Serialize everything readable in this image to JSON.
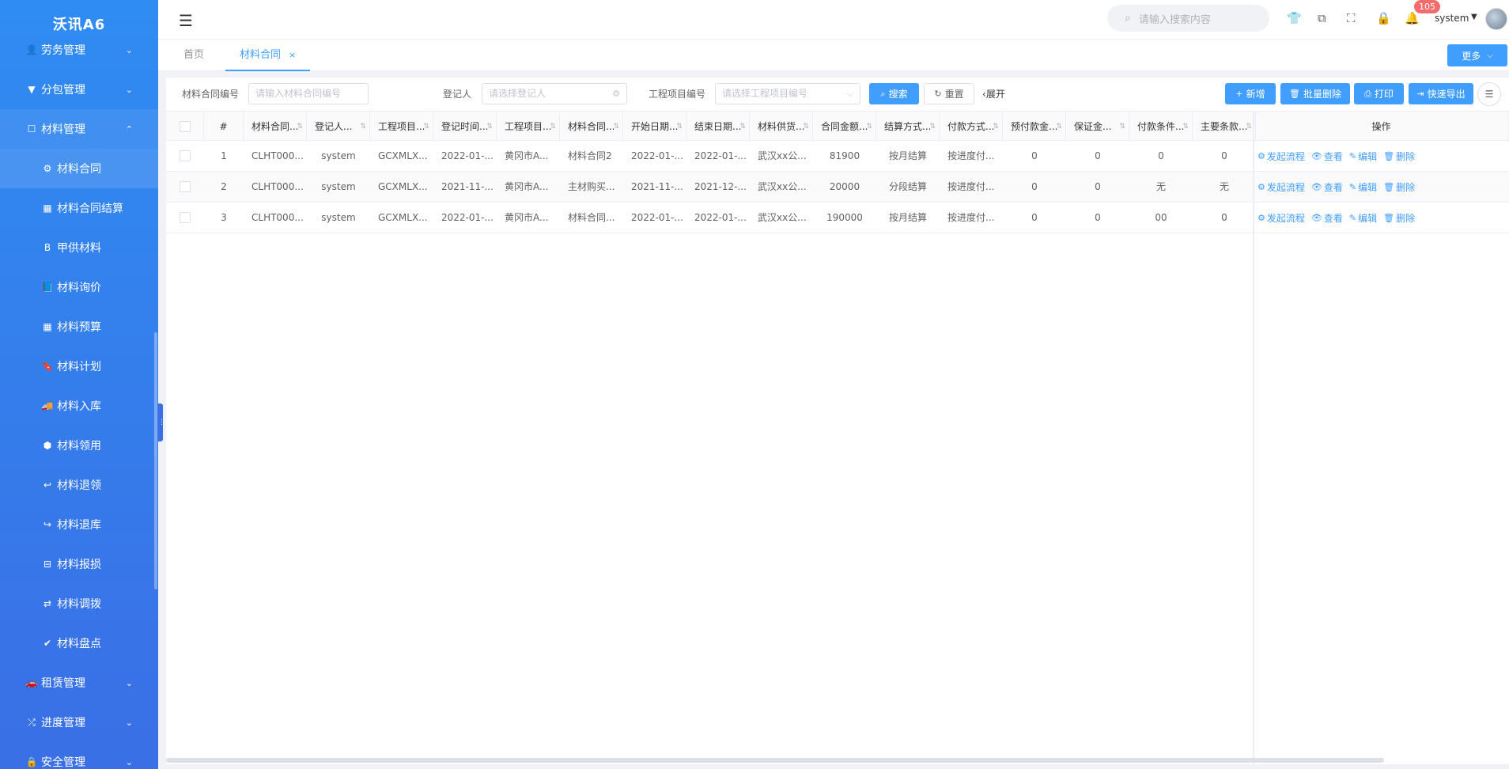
{
  "app": {
    "brand": "沃讯A6"
  },
  "sidebar": {
    "items": [
      {
        "icon": "user-icon",
        "glyph": "👤",
        "label": "劳务管理",
        "type": "top",
        "arrow": "⌄"
      },
      {
        "icon": "filter-icon",
        "glyph": "▼",
        "label": "分包管理",
        "type": "top",
        "arrow": "⌄"
      },
      {
        "icon": "square-icon",
        "glyph": "☐",
        "label": "材料管理",
        "type": "top",
        "arrow": "⌃"
      },
      {
        "icon": "cogs-icon",
        "glyph": "⚙",
        "label": "材料合同",
        "type": "sub"
      },
      {
        "icon": "calculator-icon",
        "glyph": "▦",
        "label": "材料合同结算",
        "type": "sub"
      },
      {
        "icon": "bold-icon",
        "glyph": "B",
        "label": "甲供材料",
        "type": "sub"
      },
      {
        "icon": "book-icon",
        "glyph": "📘",
        "label": "材料询价",
        "type": "sub"
      },
      {
        "icon": "calculator-icon",
        "glyph": "▦",
        "label": "材料预算",
        "type": "sub"
      },
      {
        "icon": "bookmark-icon",
        "glyph": "🔖",
        "label": "材料计划",
        "type": "sub"
      },
      {
        "icon": "truck-icon",
        "glyph": "🚚",
        "label": "材料入库",
        "type": "sub"
      },
      {
        "icon": "cube-icon",
        "glyph": "⬢",
        "label": "材料领用",
        "type": "sub"
      },
      {
        "icon": "reply-icon",
        "glyph": "↩",
        "label": "材料退领",
        "type": "sub"
      },
      {
        "icon": "share-icon",
        "glyph": "↪",
        "label": "材料退库",
        "type": "sub"
      },
      {
        "icon": "minus-square-icon",
        "glyph": "⊟",
        "label": "材料报损",
        "type": "sub"
      },
      {
        "icon": "exchange-icon",
        "glyph": "⇄",
        "label": "材料调拨",
        "type": "sub"
      },
      {
        "icon": "check-circle-icon",
        "glyph": "✔",
        "label": "材料盘点",
        "type": "sub"
      },
      {
        "icon": "car-icon",
        "glyph": "🚗",
        "label": "租赁管理",
        "type": "top",
        "arrow": "⌄"
      },
      {
        "icon": "random-icon",
        "glyph": "⤮",
        "label": "进度管理",
        "type": "top",
        "arrow": "⌄"
      },
      {
        "icon": "lock-icon",
        "glyph": "🔒",
        "label": "安全管理",
        "type": "top",
        "arrow": "⌄"
      }
    ]
  },
  "header": {
    "search_placeholder": "请输入搜索内容",
    "notification_count": "105",
    "user": "system"
  },
  "tabs": [
    {
      "label": "首页",
      "closable": false
    },
    {
      "label": "材料合同",
      "closable": true
    }
  ],
  "more_label": "更多",
  "filters": {
    "contract_no_label": "材料合同编号",
    "contract_no_placeholder": "请输入材料合同编号",
    "registrant_label": "登记人",
    "registrant_placeholder": "请选择登记人",
    "project_no_label": "工程项目编号",
    "project_no_placeholder": "请选择工程项目编号",
    "search_label": "搜索",
    "reset_label": "重置",
    "expand_label": "展开"
  },
  "actions": {
    "add": "新增",
    "batch_delete": "批量删除",
    "print": "打印",
    "export": "快速导出"
  },
  "table": {
    "columns": [
      "#",
      "材料合同...",
      "登记人...",
      "工程项目...",
      "登记时间...",
      "工程项目...",
      "材料合同...",
      "开始日期...",
      "结束日期...",
      "材料供货...",
      "合同金额...",
      "结算方式...",
      "付款方式...",
      "预付款金...",
      "保证金...",
      "付款条件...",
      "主要条款..."
    ],
    "ops_header": "操作",
    "rows": [
      [
        "1",
        "CLHT000...",
        "system",
        "GCXMLX...",
        "2022-01-...",
        "黄冈市A...",
        "材料合同2",
        "2022-01-...",
        "2022-01-...",
        "武汉xx公...",
        "81900",
        "按月结算",
        "按进度付...",
        "0",
        "0",
        "0",
        "0"
      ],
      [
        "2",
        "CLHT000...",
        "system",
        "GCXMLX...",
        "2021-11-...",
        "黄冈市A...",
        "主材购买...",
        "2021-11-...",
        "2021-12-...",
        "武汉xx公...",
        "20000",
        "分段结算",
        "按进度付...",
        "0",
        "0",
        "无",
        "无"
      ],
      [
        "3",
        "CLHT000...",
        "system",
        "GCXMLX...",
        "2022-01-...",
        "黄冈市A...",
        "材料合同...",
        "2022-01-...",
        "2022-01-...",
        "武汉xx公...",
        "190000",
        "按月结算",
        "按进度付...",
        "0",
        "0",
        "00",
        "0"
      ]
    ],
    "row_ops": [
      "发起流程",
      "查看",
      "编辑",
      "删除"
    ]
  },
  "colors": {
    "primary": "#409eff",
    "sidebar_top": "#2f8cf2",
    "sidebar_bottom": "#3a6fe6",
    "badge": "#f56c6c"
  }
}
